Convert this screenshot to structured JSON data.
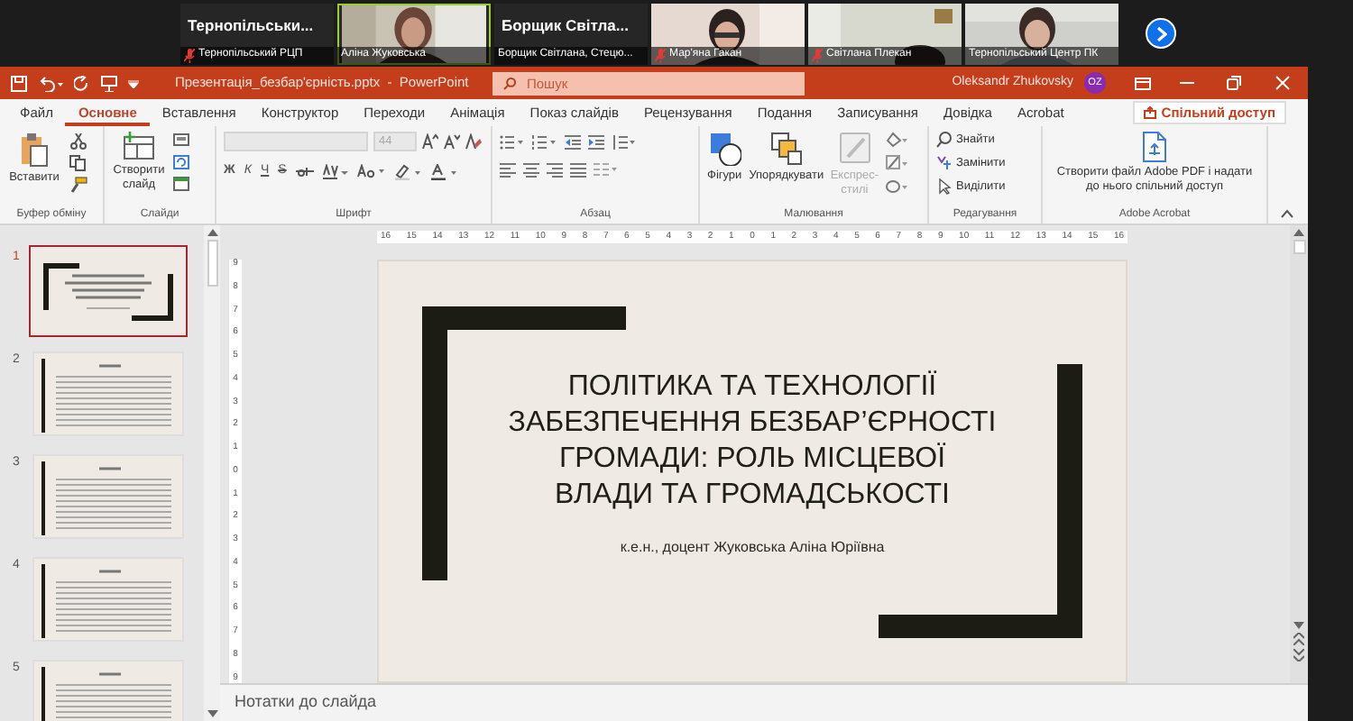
{
  "meeting": {
    "participants": [
      {
        "kind": "name",
        "title": "Тернопільськи...",
        "label": "Тернопільський РЦП",
        "muted": true,
        "speaking": false
      },
      {
        "kind": "video",
        "label": "Аліна Жуковська",
        "muted": false,
        "speaking": true
      },
      {
        "kind": "name",
        "title": "Борщик Світла...",
        "label": "Борщик Світлана, Стецю...",
        "muted": false,
        "speaking": false
      },
      {
        "kind": "video",
        "label": "Мар'яна Гакан",
        "muted": true,
        "speaking": false
      },
      {
        "kind": "video",
        "label": "Світлана Плекан",
        "muted": true,
        "speaking": false
      },
      {
        "kind": "video",
        "label": "Тернопільський Центр ПК",
        "muted": false,
        "speaking": false
      }
    ]
  },
  "window": {
    "title": "Презентація_безбар'єрність.pptx  -  PowerPoint",
    "search_placeholder": "Пошук",
    "user": "Oleksandr Zhukovsky",
    "avatar": "OZ"
  },
  "tabs": [
    {
      "label": "Файл",
      "selected": false
    },
    {
      "label": "Основне",
      "selected": true
    },
    {
      "label": "Вставлення",
      "selected": false
    },
    {
      "label": "Конструктор",
      "selected": false
    },
    {
      "label": "Переходи",
      "selected": false
    },
    {
      "label": "Анімація",
      "selected": false
    },
    {
      "label": "Показ слайдів",
      "selected": false
    },
    {
      "label": "Рецензування",
      "selected": false
    },
    {
      "label": "Подання",
      "selected": false
    },
    {
      "label": "Записування",
      "selected": false
    },
    {
      "label": "Довідка",
      "selected": false
    },
    {
      "label": "Acrobat",
      "selected": false
    }
  ],
  "share_button": "Спільний доступ",
  "ribbon": [
    {
      "kind": "clipboard",
      "label": "Буфер обміну",
      "main": "Вставити"
    },
    {
      "kind": "slides",
      "label": "Слайди",
      "main": "Створити слайд"
    },
    {
      "kind": "font",
      "label": "Шрифт",
      "size": "44",
      "format": [
        "Ж",
        "К",
        "Ч",
        "S"
      ]
    },
    {
      "kind": "paragraph",
      "label": "Абзац"
    },
    {
      "kind": "drawing",
      "label": "Малювання",
      "buttons": [
        {
          "label": "Фігури",
          "disabled": false
        },
        {
          "label": "Упорядкувати",
          "disabled": false
        },
        {
          "label": "Експрес-стилі",
          "disabled": true
        }
      ]
    },
    {
      "kind": "editing",
      "label": "Редагування",
      "buttons": [
        "Знайти",
        "Замінити",
        "Виділити"
      ]
    },
    {
      "kind": "acrobat",
      "label": "Adobe Acrobat",
      "main": "Створити файл Adobe PDF і надати до нього спільний доступ"
    }
  ],
  "ruler": {
    "horizontal": [
      "16",
      "15",
      "14",
      "13",
      "12",
      "11",
      "10",
      "9",
      "8",
      "7",
      "6",
      "5",
      "4",
      "3",
      "2",
      "1",
      "0",
      "1",
      "2",
      "3",
      "4",
      "5",
      "6",
      "7",
      "8",
      "9",
      "10",
      "11",
      "12",
      "13",
      "14",
      "15",
      "16"
    ],
    "vertical": [
      "9",
      "8",
      "7",
      "6",
      "5",
      "4",
      "3",
      "2",
      "1",
      "0",
      "1",
      "2",
      "3",
      "4",
      "5",
      "6",
      "7",
      "8",
      "9"
    ]
  },
  "slides": [
    {
      "number": "1",
      "selected": true,
      "kind": "title"
    },
    {
      "number": "2",
      "selected": false,
      "kind": "text"
    },
    {
      "number": "3",
      "selected": false,
      "kind": "text"
    },
    {
      "number": "4",
      "selected": false,
      "kind": "text"
    },
    {
      "number": "5",
      "selected": false,
      "kind": "text"
    }
  ],
  "current_slide": {
    "title_lines": [
      "ПОЛІТИКА ТА ТЕХНОЛОГІЇ",
      "ЗАБЕЗПЕЧЕННЯ БЕЗБАР’ЄРНОСТІ",
      "ГРОМАДИ: РОЛЬ МІСЦЕВОЇ",
      "ВЛАДИ ТА ГРОМАДСЬКОСТІ"
    ],
    "subtitle": "к.е.н., доцент Жуковська Аліна Юріївна"
  },
  "notes": "Нотатки до слайда"
}
